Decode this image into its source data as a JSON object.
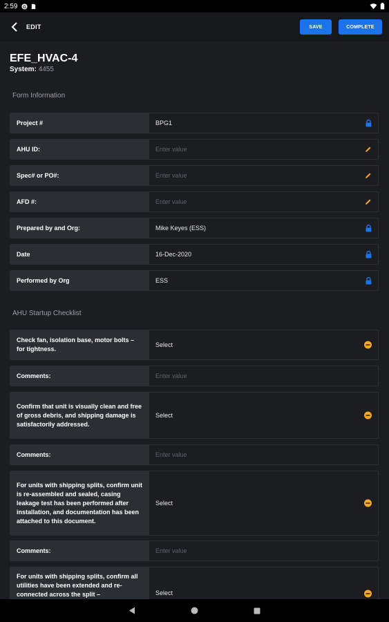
{
  "status_bar": {
    "time": "2:59"
  },
  "app_bar": {
    "title": "EDIT",
    "save_label": "SAVE",
    "complete_label": "COMPLETE"
  },
  "asset": {
    "title": "EFE_HVAC-4",
    "system_label": "System:",
    "system_value": "4455"
  },
  "sections": {
    "form_info": "Form Information",
    "checklist": "AHU Startup Checklist"
  },
  "form_fields": [
    {
      "label": "Project #",
      "value": "BPG1",
      "icon": "lock-icon"
    },
    {
      "label": "AHU ID:",
      "placeholder": "Enter value",
      "icon": "pencil-icon"
    },
    {
      "label": "Spec# or PO#:",
      "placeholder": "Enter value",
      "icon": "pencil-icon"
    },
    {
      "label": "AFD #:",
      "placeholder": "Enter value",
      "icon": "pencil-icon"
    },
    {
      "label": "Prepared by and Org:",
      "value": "Mike Keyes (ESS)",
      "icon": "lock-icon"
    },
    {
      "label": "Date",
      "value": "16-Dec-2020",
      "icon": "lock-icon"
    },
    {
      "label": "Performed by Org",
      "value": "ESS",
      "icon": "lock-icon"
    }
  ],
  "checklist": [
    {
      "label": "Check fan, isolation base, motor bolts – for tightness.",
      "value": "Select",
      "icon": "dropdown-circle-icon"
    },
    {
      "label": "Comments:",
      "placeholder": "Enter value"
    },
    {
      "label": "Confirm that unit is visually clean and free of gross debris, and shipping damage is satisfactorily addressed.",
      "value": "Select",
      "icon": "dropdown-circle-icon"
    },
    {
      "label": "Comments:",
      "placeholder": "Enter value"
    },
    {
      "label": "For units with shipping splits, confirm unit is re-assembled and sealed, casing leakage test has been performed after installation, and documentation has been attached to this document.",
      "value": "Select",
      "icon": "dropdown-circle-icon"
    },
    {
      "label": "Comments:",
      "placeholder": "Enter value"
    },
    {
      "label": "For units with shipping splits, confirm all utilities have been extended and re-connected across the split –",
      "value": "Select",
      "icon": "dropdown-circle-icon"
    }
  ],
  "colors": {
    "accent": "#1a73e8",
    "lock": "#1a73e8",
    "edit": "#f5a623",
    "dropdown": "#f5a623"
  }
}
